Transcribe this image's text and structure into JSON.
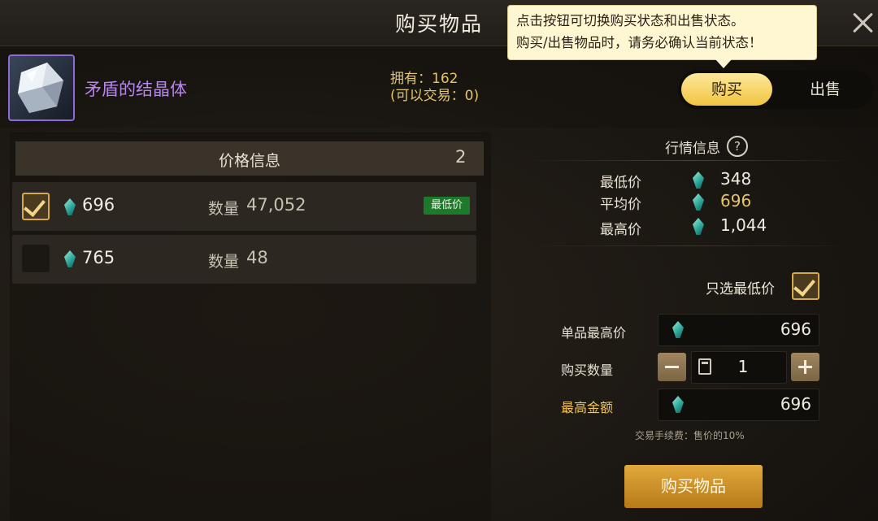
{
  "dialog": {
    "title": "购买物品"
  },
  "tooltip": {
    "line1": "点击按钮可切换购买状态和出售状态。",
    "line2": "购买/出售物品时，请务必确认当前状态！"
  },
  "item": {
    "name": "矛盾的结晶体",
    "owned": "拥有：162",
    "tradable": "(可以交易：0)",
    "icon": "crystal-icon"
  },
  "mode_toggle": {
    "buy": "购买",
    "sell": "出售",
    "active": "buy"
  },
  "price_list": {
    "header": "价格信息",
    "count": "2",
    "qty_label": "数量",
    "rows": [
      {
        "price": "696",
        "qty": "47,052",
        "checked": true,
        "badge": "最低价"
      },
      {
        "price": "765",
        "qty": "48",
        "checked": false,
        "badge": ""
      }
    ]
  },
  "market": {
    "title": "行情信息",
    "help_icon": "?",
    "min_label": "最低价",
    "min": "348",
    "avg_label": "平均价",
    "avg": "696",
    "max_label": "最高价",
    "max": "1,044"
  },
  "form": {
    "only_lowest_label": "只选最低价",
    "only_lowest_checked": true,
    "unit_max_label": "单品最高价",
    "unit_max": "696",
    "quantity_label": "购买数量",
    "quantity": "1",
    "minus": "−",
    "plus": "+",
    "total_label": "最高金额",
    "total": "696",
    "fee_note": "交易手续费：售价的10%",
    "buy_button": "购买物品"
  },
  "colors": {
    "accent_gold": "#f1c540",
    "item_purple": "#b786ef",
    "avg_price": "#e8c468",
    "badge_green": "#1d7a2b"
  }
}
